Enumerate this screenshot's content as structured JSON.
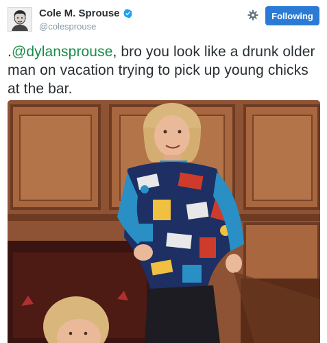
{
  "author": {
    "display_name": "Cole M. Sprouse",
    "handle": "@colesprouse",
    "verified_icon": "verified-badge-icon",
    "avatar_icon": "avatar-portrait"
  },
  "actions": {
    "settings_icon": "gear-icon",
    "follow_label": "Following"
  },
  "tweet": {
    "prefix": ".",
    "mention": "@dylansprouse",
    "body": ", bro you look like a drunk older man on vacation trying to pick up young chicks at the bar."
  },
  "media": {
    "type": "photo",
    "description_icon": "tweet-photo"
  },
  "colors": {
    "follow_button": "#2b7bd5",
    "mention": "#1b8a4a",
    "handle": "#8899a6",
    "verified": "#1da1f2"
  }
}
